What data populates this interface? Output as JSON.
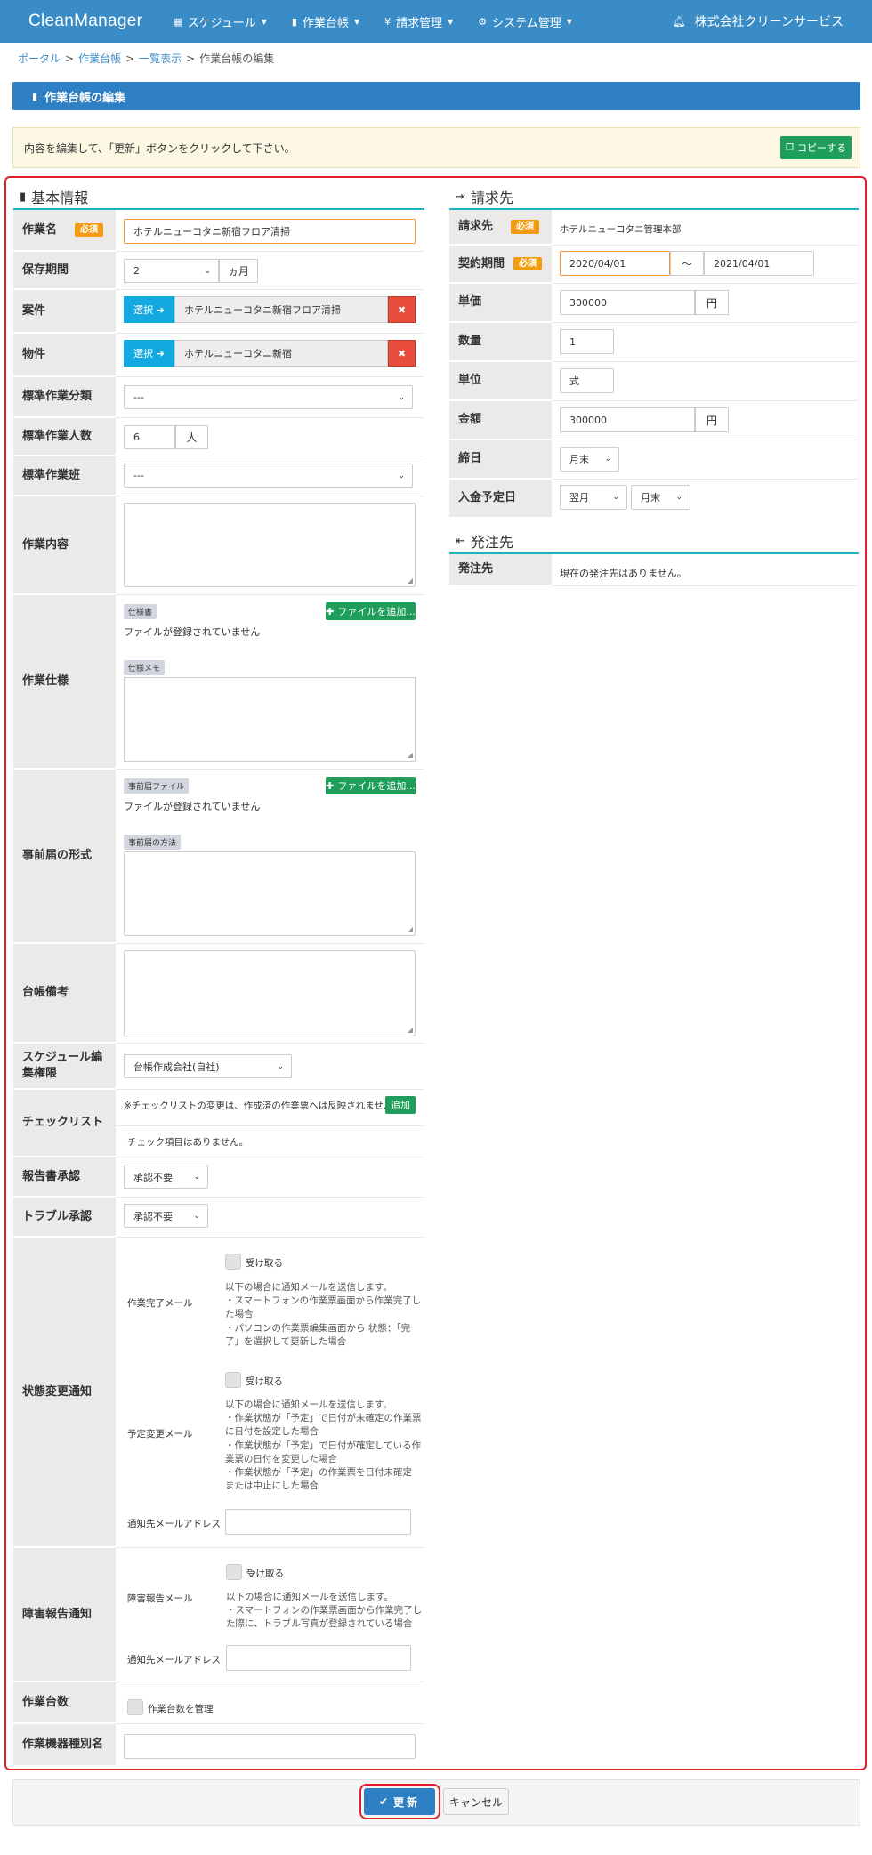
{
  "nav": {
    "brand": "CleanManager",
    "menus": [
      {
        "icon": "calendar-icon",
        "label": "スケジュール"
      },
      {
        "icon": "book-icon",
        "label": "作業台帳"
      },
      {
        "icon": "yen-icon",
        "label": "請求管理"
      },
      {
        "icon": "gears-icon",
        "label": "システム管理"
      }
    ],
    "company": "株式会社クリーンサービス"
  },
  "breadcrumb": [
    "ポータル",
    "作業台帳",
    "一覧表示",
    "作業台帳の編集"
  ],
  "page_title": "作業台帳の編集",
  "notice": {
    "text": "内容を編集して、「更新」ボタンをクリックして下さい。",
    "copy_label": "コピーする"
  },
  "basic": {
    "heading": "基本情報",
    "required": "必須",
    "work_name": {
      "label": "作業名",
      "value": "ホテルニューコタニ新宿フロア清掃"
    },
    "retention": {
      "label": "保存期間",
      "value": "2",
      "unit": "ヵ月"
    },
    "project": {
      "label": "案件",
      "select_label": "選択",
      "value": "ホテルニューコタニ新宿フロア清掃"
    },
    "property": {
      "label": "物件",
      "select_label": "選択",
      "value": "ホテルニューコタニ新宿"
    },
    "std_category": {
      "label": "標準作業分類",
      "value": "---"
    },
    "std_people": {
      "label": "標準作業人数",
      "value": "6",
      "unit": "人"
    },
    "std_team": {
      "label": "標準作業班",
      "value": "---"
    },
    "work_content": {
      "label": "作業内容"
    },
    "spec": {
      "label": "作業仕様",
      "tag": "仕様書",
      "empty": "ファイルが登録されていません",
      "add_label": "ファイルを追加...",
      "memo_tag": "仕様メモ"
    },
    "prior": {
      "label": "事前届の形式",
      "tag": "事前届ファイル",
      "empty": "ファイルが登録されていません",
      "add_label": "ファイルを追加...",
      "method_tag": "事前届の方法"
    },
    "ledger_note": {
      "label": "台帳備考"
    },
    "schedule_auth": {
      "label": "スケジュール編集権限",
      "value": "台帳作成会社(自社)"
    },
    "checklist": {
      "label": "チェックリスト",
      "note": "※チェックリストの変更は、作成済の作業票へは反映されません。",
      "add_label": "追加",
      "empty": "チェック項目はありません。"
    },
    "report_approval": {
      "label": "報告書承認",
      "value": "承認不要"
    },
    "trouble_approval": {
      "label": "トラブル承認",
      "value": "承認不要"
    },
    "status_notify": {
      "label": "状態変更通知",
      "receive": "受け取る",
      "complete_mail": {
        "label": "作業完了メール",
        "desc": [
          "以下の場合に通知メールを送信します。",
          "・スマートフォンの作業票画面から作業完了し",
          "た場合",
          "・パソコンの作業票編集画面から 状態：「完",
          "了」を選択して更新した場合"
        ]
      },
      "schedule_mail": {
        "label": "予定変更メール",
        "desc": [
          "以下の場合に通知メールを送信します。",
          "・作業状態が「予定」で日付が未確定の作業票",
          "に日付を設定した場合",
          "・作業状態が「予定」で日付が確定している作",
          "業票の日付を変更した場合",
          "・作業状態が「予定」の作業票を日付未確定",
          "または中止にした場合"
        ]
      },
      "address_label": "通知先メールアドレス"
    },
    "fault_notify": {
      "label": "障害報告通知",
      "receive": "受け取る",
      "fault_mail": {
        "label": "障害報告メール",
        "desc": [
          "以下の場合に通知メールを送信します。",
          "・スマートフォンの作業票画面から作業完了し",
          "た際に、トラブル写真が登録されている場合"
        ]
      },
      "address_label": "通知先メールアドレス"
    },
    "work_count": {
      "label": "作業台数",
      "checkbox": "作業台数を管理"
    },
    "equipment_alias": {
      "label": "作業機器種別名"
    }
  },
  "billing": {
    "heading": "請求先",
    "required": "必須",
    "client": {
      "label": "請求先",
      "value": "ホテルニューコタニ管理本部"
    },
    "period": {
      "label": "契約期間",
      "from": "2020/04/01",
      "tilde": "～",
      "to": "2021/04/01"
    },
    "unit_price": {
      "label": "単価",
      "value": "300000",
      "unit": "円"
    },
    "quantity": {
      "label": "数量",
      "value": "1"
    },
    "unit": {
      "label": "単位",
      "value": "式"
    },
    "amount": {
      "label": "金額",
      "value": "300000",
      "unit": "円"
    },
    "closing": {
      "label": "締日",
      "value": "月末"
    },
    "payment": {
      "label": "入金予定日",
      "month": "翌月",
      "day": "月末"
    }
  },
  "order": {
    "heading": "発注先",
    "supplier": {
      "label": "発注先",
      "value": "現在の発注先はありません。"
    }
  },
  "footer": {
    "update_label": "更新",
    "cancel_label": "キャンセル"
  }
}
